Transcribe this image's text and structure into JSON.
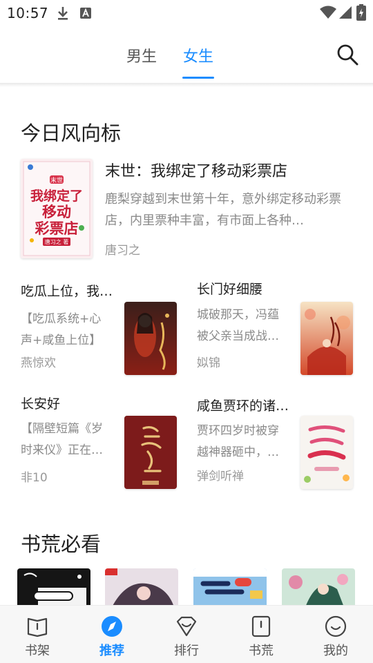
{
  "status_bar": {
    "time": "10:57"
  },
  "top_tabs": {
    "tabs": [
      {
        "label": "男生"
      },
      {
        "label": "女生"
      }
    ],
    "active": "女生",
    "accent_color": "#1a8cff"
  },
  "section_trending": {
    "title": "今日风向标",
    "featured": {
      "title": "末世：我绑定了移动彩票店",
      "description": "鹿梨穿越到末世第十年，意外绑定移动彩票店，内里票种丰富，有市面上各种…",
      "author": "唐习之",
      "cover_text": [
        "我绑定了",
        "移动",
        "彩票店"
      ],
      "cover_badge": "末世",
      "cover_author": "唐习之 著"
    },
    "books": [
      {
        "title": "吃瓜上位，我…",
        "description": "【吃瓜系统+心声+咸鱼上位】 …",
        "author": "燕惊欢"
      },
      {
        "title": "长门好细腰",
        "description": "城破那天，冯蕴被父亲当成战…",
        "author": "姒锦"
      },
      {
        "title": "长安好",
        "description": "【隔壁短篇《岁时来仪》正在…",
        "author": "非10"
      },
      {
        "title": "咸鱼贾环的诸…",
        "description": "贾环四岁时被穿越神器砸中，…",
        "author": "弹剑听禅"
      }
    ]
  },
  "section_must_read": {
    "title": "书荒必看"
  },
  "bottom_nav": {
    "items": [
      {
        "label": "书架",
        "icon": "bookshelf-icon"
      },
      {
        "label": "推荐",
        "icon": "compass-icon"
      },
      {
        "label": "排行",
        "icon": "ranking-icon"
      },
      {
        "label": "书荒",
        "icon": "book-icon"
      },
      {
        "label": "我的",
        "icon": "profile-icon"
      }
    ],
    "active": "推荐"
  }
}
